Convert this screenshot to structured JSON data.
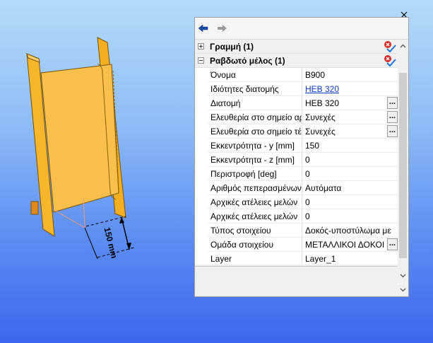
{
  "dimension": {
    "text": "150 mm"
  },
  "panel": {
    "groups": [
      {
        "label": "Γραμμή (1)",
        "expanded": false
      },
      {
        "label": "Ραβδωτό μέλος (1)",
        "expanded": true
      }
    ],
    "properties": [
      {
        "name": "Όνομα",
        "value": "B900",
        "has_button": false,
        "is_link": false
      },
      {
        "name": "Ιδιότητες διατομής",
        "value": "HEB 320",
        "has_button": false,
        "is_link": true
      },
      {
        "name": "Διατομή",
        "value": "HEB 320",
        "has_button": true,
        "is_link": false
      },
      {
        "name": "Ελευθερία στο σημείο αρ",
        "value": "Συνεχές",
        "has_button": true,
        "is_link": false
      },
      {
        "name": "Ελευθερία στο σημείο τέ",
        "value": "Συνεχές",
        "has_button": true,
        "is_link": false
      },
      {
        "name": "Εκκεντρότητα - y [mm]",
        "value": "150",
        "has_button": false,
        "is_link": false
      },
      {
        "name": "Εκκεντρότητα - z [mm]",
        "value": "0",
        "has_button": false,
        "is_link": false
      },
      {
        "name": "Περιστροφή [deg]",
        "value": "0",
        "has_button": false,
        "is_link": false
      },
      {
        "name": "Αριθμός πεπερασμένων",
        "value": "Αυτόματα",
        "has_button": false,
        "is_link": false
      },
      {
        "name": "Αρχικές ατέλειες μελών",
        "value": "0",
        "has_button": false,
        "is_link": false
      },
      {
        "name": "Αρχικές ατέλειες μελών",
        "value": "0",
        "has_button": false,
        "is_link": false
      },
      {
        "name": "Τύπος στοιχείου",
        "value": "Δοκός-υποστύλωμα με",
        "has_button": false,
        "is_link": false
      },
      {
        "name": "Ομάδα στοιχείου",
        "value": "ΜΕΤΑΛΛΙΚΟΙ ΔΟΚΟΙ",
        "has_button": true,
        "is_link": false
      },
      {
        "name": "Layer",
        "value": "Layer_1",
        "has_button": false,
        "is_link": false
      }
    ],
    "button_label": "..."
  },
  "colors": {
    "steel_yellow": "#f7b52b",
    "steel_edge": "#7a5200",
    "link_blue": "#0b3cc4",
    "accent_check": "#1e74d6"
  },
  "icons": {
    "back": "arrow-left-icon",
    "forward": "arrow-right-icon",
    "group_action": "delete-check-icon",
    "close": "close-icon"
  }
}
